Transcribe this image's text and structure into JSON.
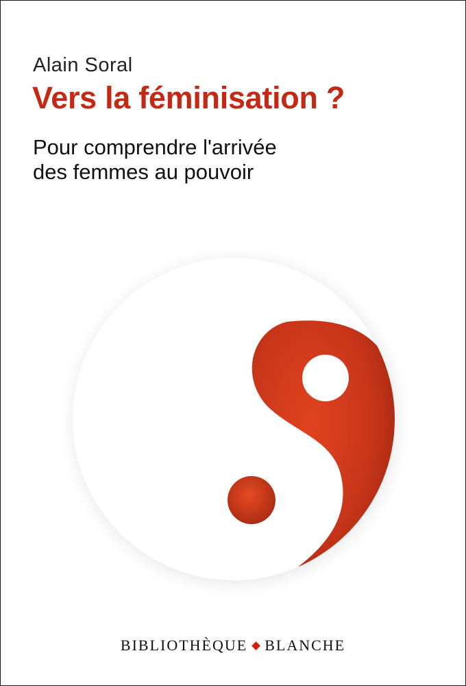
{
  "cover": {
    "author": "Alain Soral",
    "title": "Vers la féminisation ?",
    "subtitle_lines": [
      "Pour comprendre l'arrivée",
      "des femmes au pouvoir"
    ],
    "collection": {
      "left": "BIBLIOTHÈQUE",
      "right": "BLANCHE"
    }
  },
  "colors": {
    "title": "#c22a16",
    "emblem_red": "#c8361a",
    "emblem_white": "#ffffff",
    "separator_diamond": "#d21f0e"
  },
  "icons": {
    "emblem": "yin-yang-icon",
    "separator": "diamond-icon"
  }
}
